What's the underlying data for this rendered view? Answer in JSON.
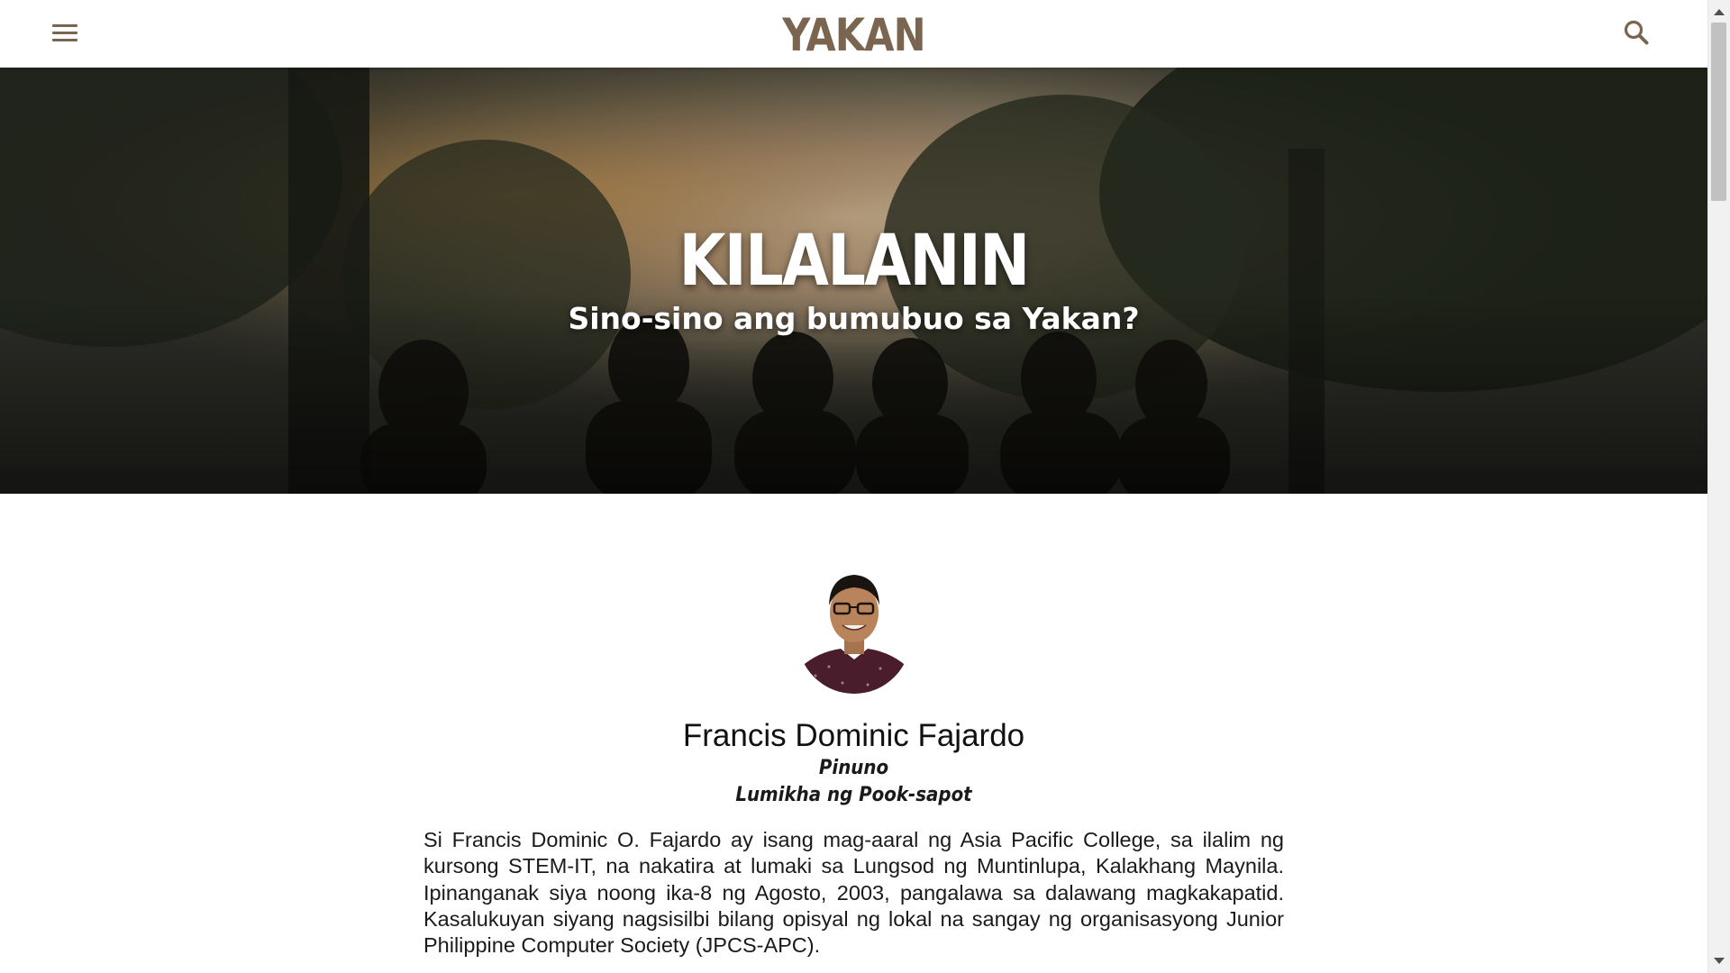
{
  "header": {
    "logo_text": "YAKAN",
    "menu_icon": "hamburger-menu-icon",
    "search_icon": "search-icon",
    "accent_color": "#7a6650"
  },
  "hero": {
    "title": "KILALANIN",
    "subtitle": "Sino-sino ang bumubuo sa Yakan?"
  },
  "profile": {
    "name": "Francis Dominic Fajardo",
    "roles": [
      "Pinuno",
      "Lumikha ng Pook-sapot"
    ],
    "bio": "Si Francis Dominic O. Fajardo ay isang mag-aaral ng Asia Pacific College, sa ilalim ng kursong STEM-IT, na nakatira at lumaki sa Lungsod ng Muntinlupa, Kalakhang Maynila. Ipinanganak siya noong ika-8 ng Agosto, 2003, pangalawa sa dalawang magkakapatid. Kasalukuyan siyang nagsisilbi bilang opisyal ng lokal na sangay ng organisasyong Junior Philippine Computer Society (JPCS-APC)."
  }
}
